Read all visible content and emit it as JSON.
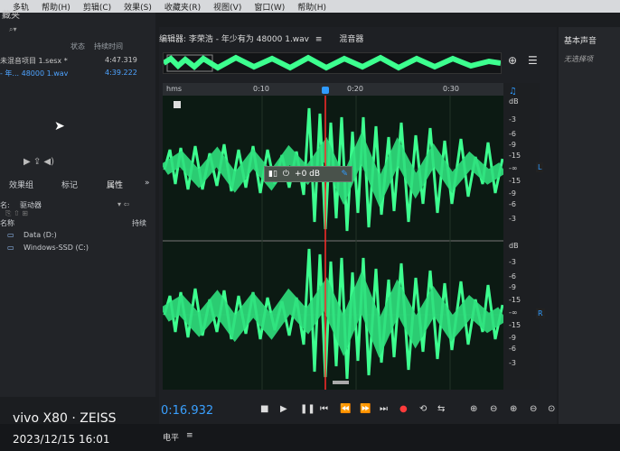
{
  "menu": [
    "多轨",
    "帮助(H)",
    "剪辑(C)",
    "效果(S)",
    "收藏夹(R)",
    "视图(V)",
    "窗口(W)",
    "帮助(H)"
  ],
  "left": {
    "title": "藏夹",
    "col_status": "状态",
    "col_duration": "持续时间",
    "files": [
      {
        "name": "未混音项目 1.sesx *",
        "duration": "4:47.319"
      },
      {
        "name": "- 年... 48000 1.wav",
        "duration": "4:39.222"
      }
    ],
    "tabs": [
      "效果组",
      "标记",
      "属性"
    ],
    "location_label": "名:",
    "location_value": "驱动器",
    "name_header": "名称",
    "duration_header": "持续",
    "drives": [
      "Data (D:)",
      "Windows-SSD (C:)"
    ]
  },
  "editor": {
    "tab_label": "编辑器: 李荣浩 - 年少有为 48000 1.wav",
    "mixer_label": "混音器"
  },
  "timeline": {
    "unit": "hms",
    "ticks": [
      "0:10",
      "0:20",
      "0:30"
    ]
  },
  "hud": {
    "gain": "+0 dB"
  },
  "db_scale": {
    "top_labels": [
      "dB",
      "-3",
      "-6",
      "-9",
      "-15",
      "-∞",
      "-15",
      "-9",
      "-6",
      "-3"
    ],
    "bottom_labels": [
      "dB",
      "-3",
      "-6",
      "-9",
      "-15",
      "-∞",
      "-15",
      "-9",
      "-6",
      "-3"
    ],
    "channel_left": "L",
    "channel_right": "R"
  },
  "transport": {
    "time": "0:16.932"
  },
  "right": {
    "title": "基本声音",
    "sub": "无选择项"
  },
  "bottom_label": "电平",
  "watermark": {
    "line1": "vivo X80 · ZEISS",
    "line2": "2023/12/15 16:01"
  },
  "colors": {
    "wave": "#3dff8f",
    "playhead": "#ff2a2a",
    "accent": "#2f9bff"
  }
}
